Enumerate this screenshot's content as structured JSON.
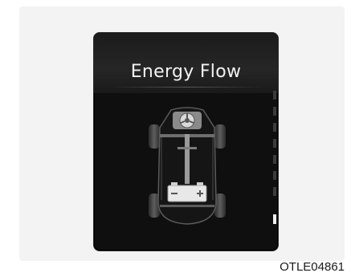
{
  "screen": {
    "title": "Energy Flow"
  },
  "reference_code": "OTLE04861"
}
